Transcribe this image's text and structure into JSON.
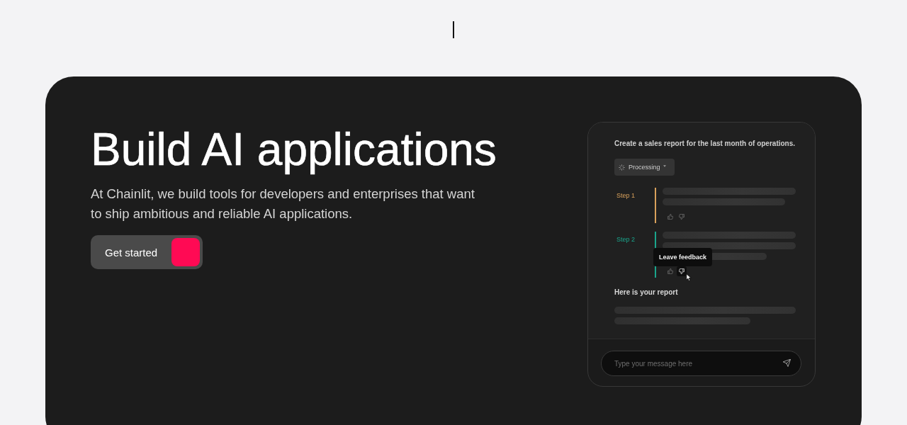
{
  "hero": {
    "title": "Build AI applications",
    "subtitle": "At Chainlit, we build tools for developers and enterprises that want to ship ambitious and reliable AI applications.",
    "cta": {
      "label": "Get started"
    }
  },
  "chat_preview": {
    "user_message": "Create a sales report for the last month of operations.",
    "status": {
      "label": "Processing"
    },
    "steps": [
      {
        "label": "Step 1",
        "color": "#d9a15b"
      },
      {
        "label": "Step 2",
        "color": "#1aa58c",
        "tooltip": "Leave feedback"
      }
    ],
    "answer_title": "Here is your report",
    "composer": {
      "placeholder": "Type your message here"
    }
  }
}
